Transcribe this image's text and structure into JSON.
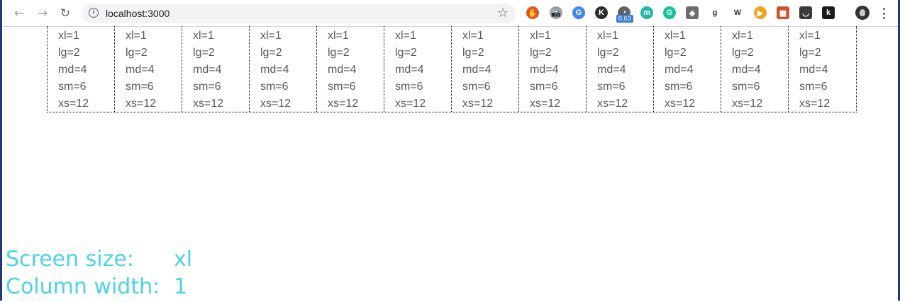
{
  "browser": {
    "url": "localhost:3000",
    "extensions": [
      {
        "icon": "ublock-icon",
        "color": "#e0541f",
        "glyph": "✋"
      },
      {
        "icon": "camera-icon",
        "color": "#9aa0a6",
        "glyph": "📷"
      },
      {
        "icon": "translate-icon",
        "color": "#4285f4",
        "glyph": "G"
      },
      {
        "icon": "k-extension-icon",
        "color": "#2d2d2d",
        "glyph": "K"
      },
      {
        "icon": "speed-meter-icon",
        "color": "#5f6368",
        "glyph": "◔"
      },
      {
        "icon": "m-extension-icon",
        "color": "#1fb8a4",
        "glyph": "m"
      },
      {
        "icon": "grammarly-icon",
        "color": "#15c39a",
        "glyph": "G"
      },
      {
        "icon": "layers-icon",
        "color": "#6d6d6d",
        "glyph": "◈"
      },
      {
        "icon": "g-extension-icon",
        "color": "#ffffff",
        "glyph": "g"
      },
      {
        "icon": "wikipedia-icon",
        "color": "#ffffff",
        "glyph": "W"
      },
      {
        "icon": "play-icon",
        "color": "#f0a31c",
        "glyph": "▶"
      },
      {
        "icon": "pixel-icon",
        "color": "#c8552b",
        "glyph": "▦"
      },
      {
        "icon": "pocket-icon",
        "color": "#3b3b3b",
        "glyph": "◡"
      },
      {
        "icon": "k-orange-icon",
        "color": "#1b1b1b",
        "glyph": "k"
      }
    ],
    "speed_badge": "0.63"
  },
  "grid": {
    "cells": [
      [
        "xl=1",
        "lg=2",
        "md=4",
        "sm=6",
        "xs=12"
      ],
      [
        "xl=1",
        "lg=2",
        "md=4",
        "sm=6",
        "xs=12"
      ],
      [
        "xl=1",
        "lg=2",
        "md=4",
        "sm=6",
        "xs=12"
      ],
      [
        "xl=1",
        "lg=2",
        "md=4",
        "sm=6",
        "xs=12"
      ],
      [
        "xl=1",
        "lg=2",
        "md=4",
        "sm=6",
        "xs=12"
      ],
      [
        "xl=1",
        "lg=2",
        "md=4",
        "sm=6",
        "xs=12"
      ],
      [
        "xl=1",
        "lg=2",
        "md=4",
        "sm=6",
        "xs=12"
      ],
      [
        "xl=1",
        "lg=2",
        "md=4",
        "sm=6",
        "xs=12"
      ],
      [
        "xl=1",
        "lg=2",
        "md=4",
        "sm=6",
        "xs=12"
      ],
      [
        "xl=1",
        "lg=2",
        "md=4",
        "sm=6",
        "xs=12"
      ],
      [
        "xl=1",
        "lg=2",
        "md=4",
        "sm=6",
        "xs=12"
      ],
      [
        "xl=1",
        "lg=2",
        "md=4",
        "sm=6",
        "xs=12"
      ]
    ]
  },
  "info": {
    "screen_size_label": "Screen size:",
    "screen_size_value": "xl",
    "column_width_label": "Column width:",
    "column_width_value": "1"
  },
  "colors": {
    "info_text": "#4dd2e6",
    "cell_text": "#595959"
  }
}
